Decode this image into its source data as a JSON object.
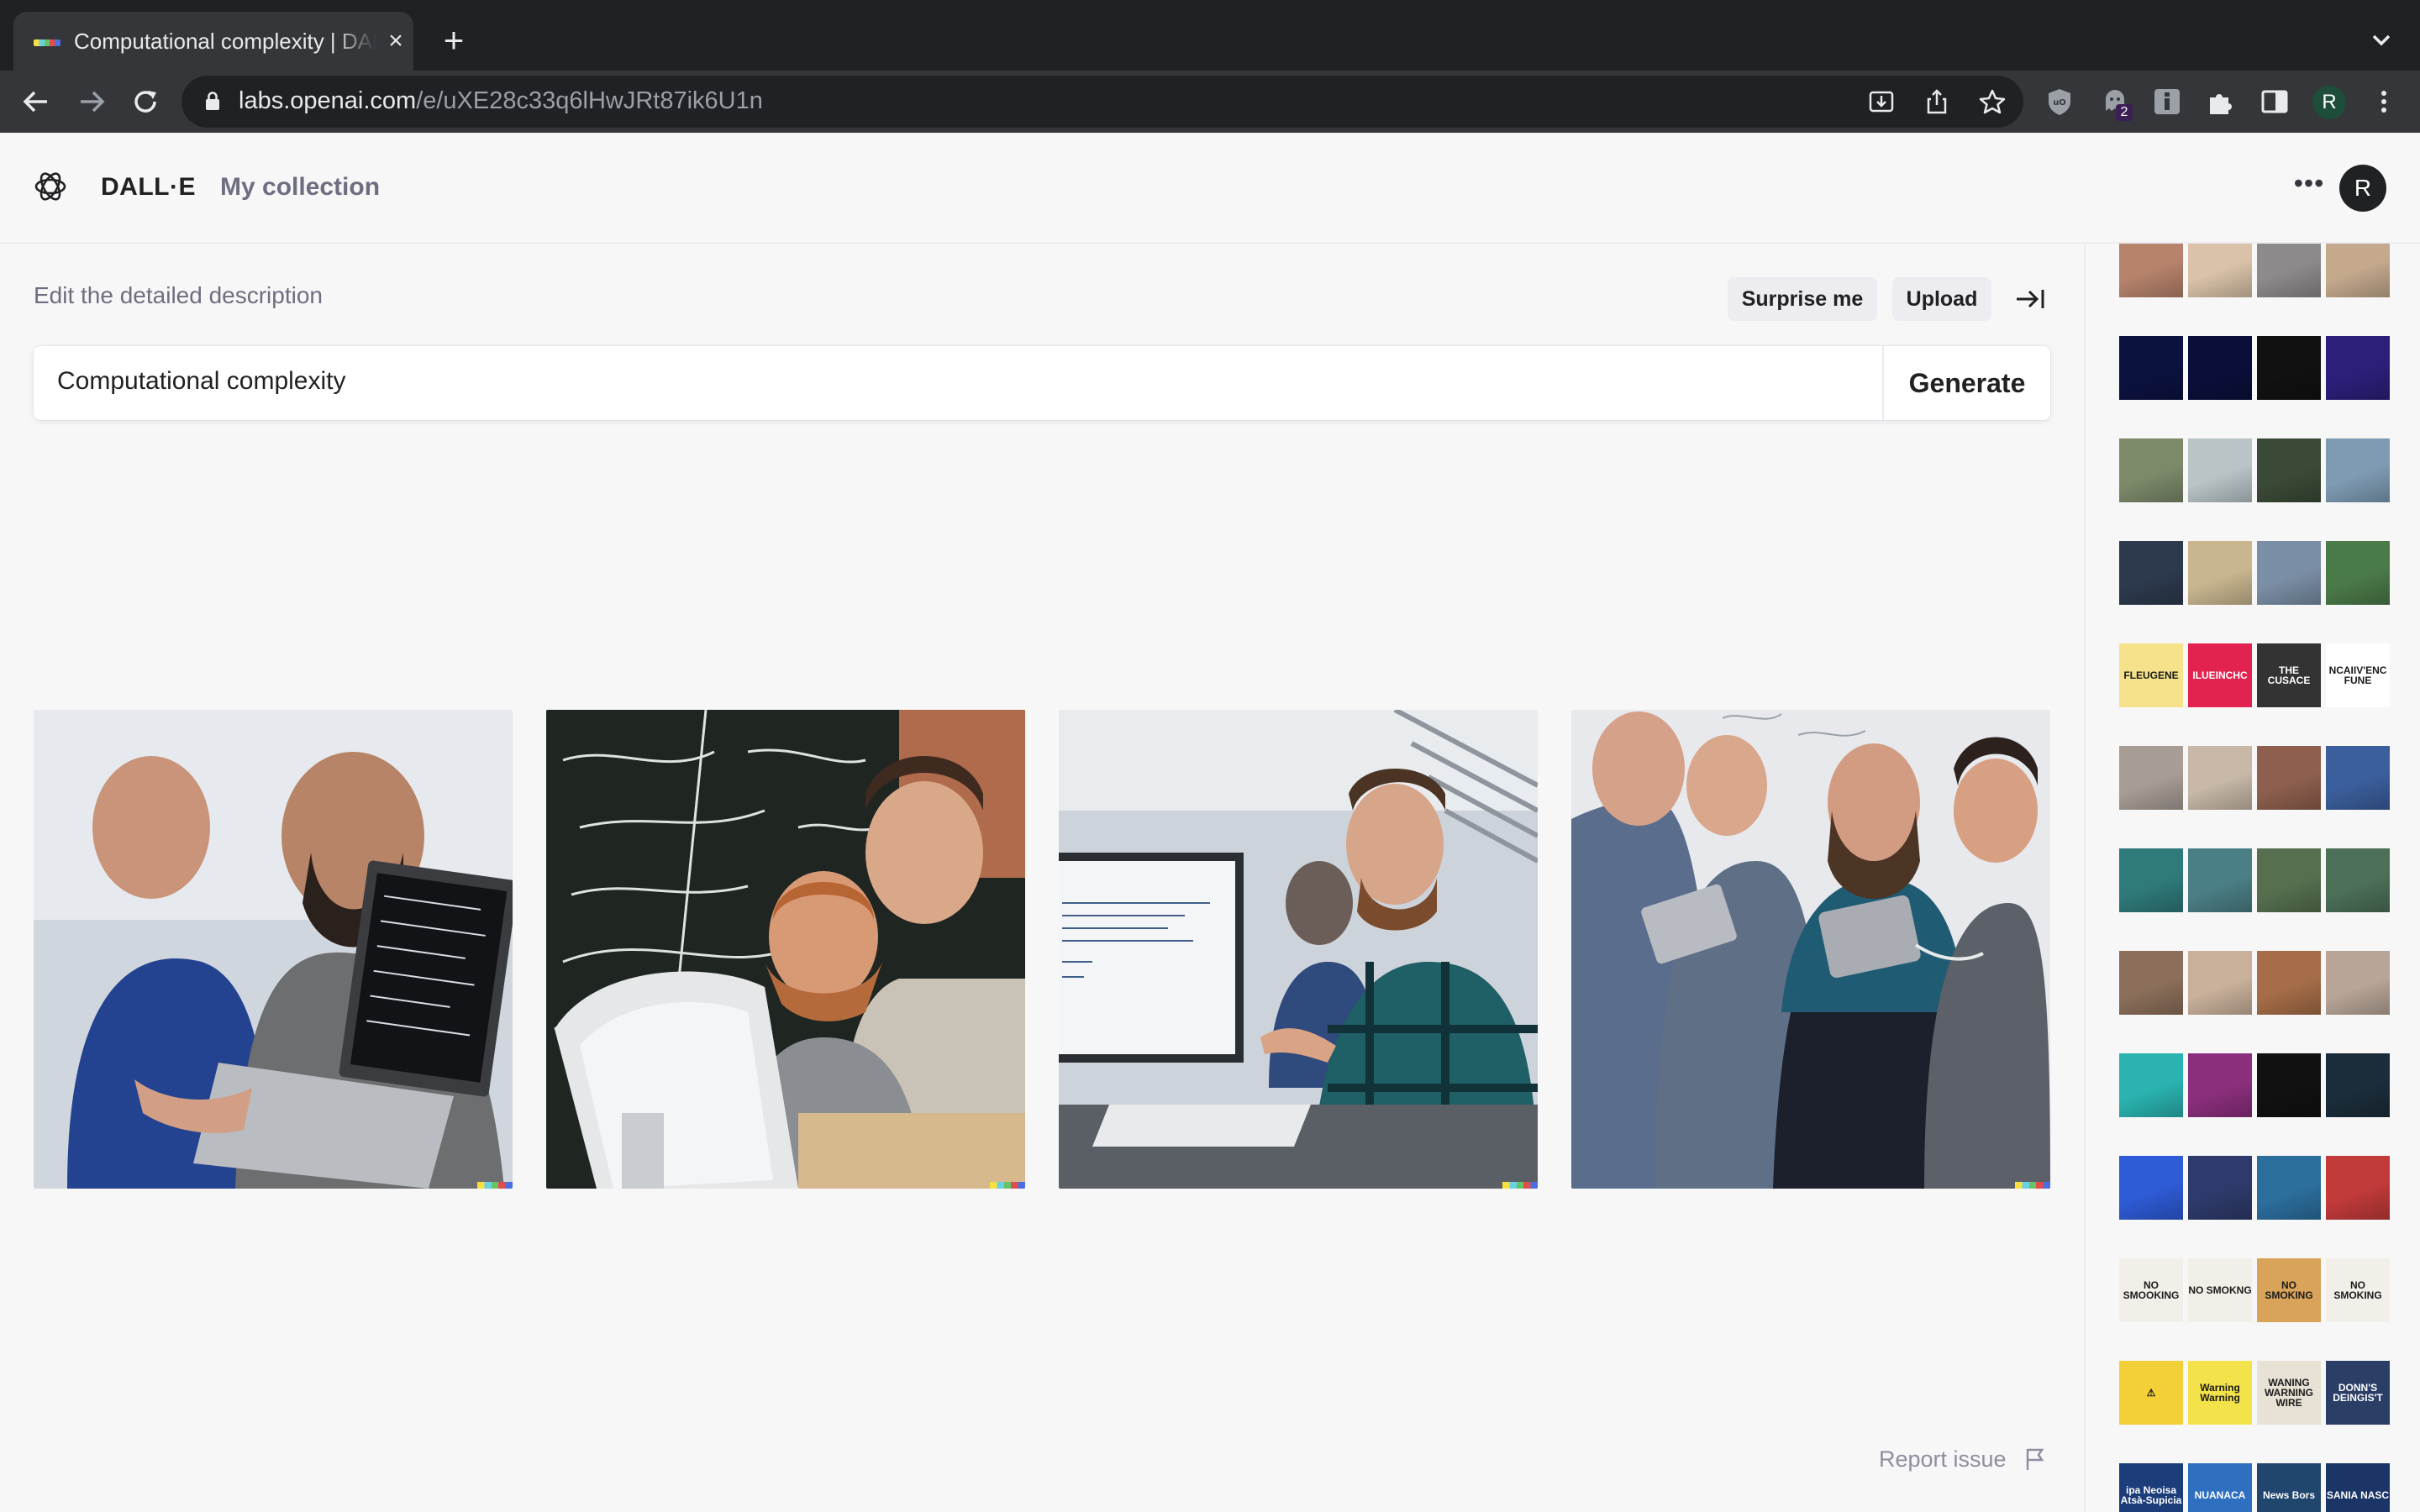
{
  "browser": {
    "tab_title": "Computational complexity | DALL·E",
    "url_host": "labs.openai.com",
    "url_path": "/e/uXE28c33q6lHwJRt87ik6U1n",
    "extension_badge": "2",
    "profile_initial": "R"
  },
  "header": {
    "brand": "DALL·E",
    "nav_collection": "My collection",
    "avatar_initial": "R"
  },
  "editor": {
    "label": "Edit the detailed description",
    "surprise_label": "Surprise me",
    "upload_label": "Upload",
    "prompt_value": "Computational complexity",
    "generate_label": "Generate"
  },
  "results": [
    {
      "scene": "two bearded men looking at a laptop with code on screen"
    },
    {
      "scene": "two men at a computer in front of a chalkboard with handwriting"
    },
    {
      "scene": "man in plaid shirt pointing at a monitor with text"
    },
    {
      "scene": "group of men with tablets in front of a whiteboard"
    }
  ],
  "footer": {
    "report_label": "Report issue"
  },
  "history": [
    {
      "theme": "portraits of women",
      "thumbs": [
        "#b7836c",
        "#d9c2a8",
        "#8d8a8c",
        "#c4a98d"
      ]
    },
    {
      "theme": "glowing blue faces",
      "thumbs": [
        "#0b1240",
        "#0a0f3a",
        "#111",
        "#2b1f7a"
      ]
    },
    {
      "theme": "landscapes",
      "thumbs": [
        "#7c8a6a",
        "#b9c4c7",
        "#3b4a36",
        "#7e9bb3"
      ]
    },
    {
      "theme": "scenic views",
      "thumbs": [
        "#2d3a4e",
        "#c9b690",
        "#7a8ea5",
        "#4b7a49"
      ]
    },
    {
      "theme": "signs with text",
      "thumbs": [
        {
          "bg": "#f6e28a",
          "t": "FLEUGENE"
        },
        {
          "bg": "#e2234f",
          "t": "ILUEINCHC"
        },
        {
          "bg": "#333",
          "t": "THE CUSACE"
        },
        {
          "bg": "#ffffff",
          "t": "NCAIIV'ENC FUNE"
        }
      ]
    },
    {
      "theme": "portraits with hands",
      "thumbs": [
        "#a79d95",
        "#c7b8a7",
        "#8e5f4e",
        "#3b5e9c"
      ]
    },
    {
      "theme": "aerial terrain",
      "thumbs": [
        "#2f7a7b",
        "#4b7f86",
        "#56704f",
        "#4c7058"
      ]
    },
    {
      "theme": "chess players",
      "thumbs": [
        "#8b6f5a",
        "#c9b19b",
        "#a56d48",
        "#b8a597"
      ]
    },
    {
      "theme": "neon cars",
      "thumbs": [
        "#2ab3b0",
        "#8b2f7d",
        "#111",
        "#1b2d3a"
      ]
    },
    {
      "theme": "cars",
      "thumbs": [
        "#2e5bd6",
        "#2e3a6b",
        "#2c6f9e",
        "#c23a3a"
      ]
    },
    {
      "theme": "no smoking signs",
      "thumbs": [
        {
          "bg": "#f2efe9",
          "t": "NO SMOOKING"
        },
        {
          "bg": "#f2efe9",
          "t": "NO SMOKNG"
        },
        {
          "bg": "#d9a35a",
          "t": "NO SMOKING"
        },
        {
          "bg": "#f2efe9",
          "t": "NO SMOKING"
        }
      ]
    },
    {
      "theme": "warning signs",
      "thumbs": [
        {
          "bg": "#f3d038",
          "t": "⚠"
        },
        {
          "bg": "#f3e24a",
          "t": "Warning Warning"
        },
        {
          "bg": "#e8e2d6",
          "t": "WANING WARNING WIRE"
        },
        {
          "bg": "#2a3e66",
          "t": "DONN'S DEINGIS'T"
        }
      ]
    },
    {
      "theme": "news banners",
      "thumbs": [
        {
          "bg": "#1c3d7a",
          "t": "ipa Neoisa Atsà-Supicia"
        },
        {
          "bg": "#2f6fbf",
          "t": "NUANACA"
        },
        {
          "bg": "#20466e",
          "t": "News Bors"
        },
        {
          "bg": "#1a3566",
          "t": "SANIA NASC"
        }
      ]
    }
  ]
}
